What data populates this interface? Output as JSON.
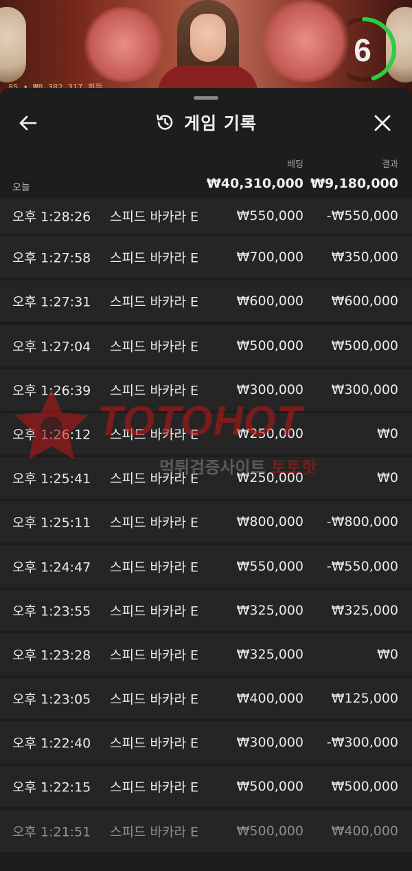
{
  "video": {
    "ticker": "85 • ₩8,382,317 회득",
    "timer": "6",
    "timer_progress": 0.45,
    "accent_color": "#2ecc40"
  },
  "header": {
    "title": "게임 기록",
    "back_icon": "arrow-left-icon",
    "history_icon": "history-icon",
    "close_icon": "close-icon"
  },
  "columns": {
    "bet_label": "베팅",
    "result_label": "결과"
  },
  "summary": {
    "date": "오늘",
    "total_bet": "₩40,310,000",
    "total_result": "₩9,180,000"
  },
  "rows": [
    {
      "time": "오후 1:28:26",
      "game": "스피드 바카라 E",
      "bet": "₩550,000",
      "result": "-₩550,000"
    },
    {
      "time": "오후 1:27:58",
      "game": "스피드 바카라 E",
      "bet": "₩700,000",
      "result": "₩350,000"
    },
    {
      "time": "오후 1:27:31",
      "game": "스피드 바카라 E",
      "bet": "₩600,000",
      "result": "₩600,000"
    },
    {
      "time": "오후 1:27:04",
      "game": "스피드 바카라 E",
      "bet": "₩500,000",
      "result": "₩500,000"
    },
    {
      "time": "오후 1:26:39",
      "game": "스피드 바카라 E",
      "bet": "₩300,000",
      "result": "₩300,000"
    },
    {
      "time": "오후 1:26:12",
      "game": "스피드 바카라 E",
      "bet": "₩250,000",
      "result": "₩0"
    },
    {
      "time": "오후 1:25:41",
      "game": "스피드 바카라 E",
      "bet": "₩250,000",
      "result": "₩0"
    },
    {
      "time": "오후 1:25:11",
      "game": "스피드 바카라 E",
      "bet": "₩800,000",
      "result": "-₩800,000"
    },
    {
      "time": "오후 1:24:47",
      "game": "스피드 바카라 E",
      "bet": "₩550,000",
      "result": "-₩550,000"
    },
    {
      "time": "오후 1:23:55",
      "game": "스피드 바카라 E",
      "bet": "₩325,000",
      "result": "₩325,000"
    },
    {
      "time": "오후 1:23:28",
      "game": "스피드 바카라 E",
      "bet": "₩325,000",
      "result": "₩0"
    },
    {
      "time": "오후 1:23:05",
      "game": "스피드 바카라 E",
      "bet": "₩400,000",
      "result": "₩125,000"
    },
    {
      "time": "오후 1:22:40",
      "game": "스피드 바카라 E",
      "bet": "₩300,000",
      "result": "-₩300,000"
    },
    {
      "time": "오후 1:22:15",
      "game": "스피드 바카라 E",
      "bet": "₩500,000",
      "result": "₩500,000"
    },
    {
      "time": "오후 1:21:51",
      "game": "스피드 바카라 E",
      "bet": "₩500,000",
      "result": "₩400,000"
    }
  ],
  "watermark": {
    "brand": "TOTOHOT",
    "sub": "먹튀검증사이트",
    "sub_accent": "토토핫",
    "color": "#c21616"
  }
}
